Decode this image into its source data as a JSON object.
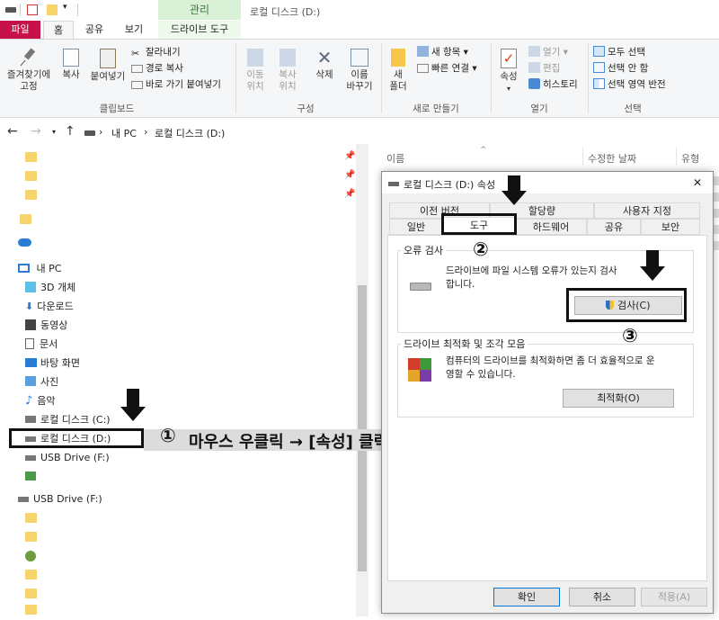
{
  "window": {
    "title": "로컬 디스크 (D:)",
    "context_tab_header": "관리"
  },
  "ribbon": {
    "tabs": {
      "file": "파일",
      "home": "홈",
      "share": "공유",
      "view": "보기",
      "drive_tools": "드라이브 도구"
    },
    "clipboard": {
      "pin_quick": "즐겨찾기에\n고정",
      "copy": "복사",
      "paste": "붙여넣기",
      "cut": "잘라내기",
      "copy_path": "경로 복사",
      "paste_shortcut": "바로 가기 붙여넣기",
      "label": "클립보드"
    },
    "organize": {
      "move_to": "이동\n위치",
      "copy_to": "복사\n위치",
      "delete": "삭제",
      "rename": "이름\n바꾸기",
      "label": "구성"
    },
    "new": {
      "new_folder": "새\n폴더",
      "new_item": "새 항목",
      "easy_access": "빠른 연결",
      "label": "새로 만들기"
    },
    "open": {
      "properties": "속성",
      "open": "열기",
      "edit": "편집",
      "history": "히스토리",
      "label": "열기"
    },
    "select": {
      "select_all": "모두 선택",
      "select_none": "선택 안 함",
      "invert": "선택 영역 반전",
      "label": "선택"
    }
  },
  "address": {
    "root": "내 PC",
    "current": "로컬 디스크 (D:)"
  },
  "columns": {
    "name": "이름",
    "modified": "수정한 날짜",
    "type": "유형"
  },
  "nav": {
    "this_pc": "내 PC",
    "items": [
      "3D 개체",
      "다운로드",
      "동영상",
      "문서",
      "바탕 화면",
      "사진",
      "음악",
      "로컬 디스크 (C:)",
      "로컬 디스크 (D:)",
      "USB Drive (F:)"
    ],
    "usb_root": "USB Drive (F:)"
  },
  "annotations": {
    "step1": "①",
    "step1_text": "마우스 우클릭 → [속성] 클릭",
    "step2": "②",
    "step3": "③"
  },
  "dialog": {
    "title": "로컬 디스크 (D:) 속성",
    "tabs_row1": [
      "이전 버전",
      "할당량",
      "사용자 지정"
    ],
    "tabs_row2": [
      "일반",
      "도구",
      "하드웨어",
      "공유",
      "보안"
    ],
    "error_check": {
      "label": "오류 검사",
      "desc": "드라이브에 파일 시스템 오류가 있는지 검사\n합니다.",
      "button": "검사(C)"
    },
    "optimize": {
      "label": "드라이브 최적화 및 조각 모음",
      "desc": "컴퓨터의 드라이브를 최적화하면 좀 더 효율적으로 운\n영할 수 있습니다.",
      "button": "최적화(O)"
    },
    "ok": "확인",
    "cancel": "취소",
    "apply": "적용(A)",
    "close": "✕"
  }
}
